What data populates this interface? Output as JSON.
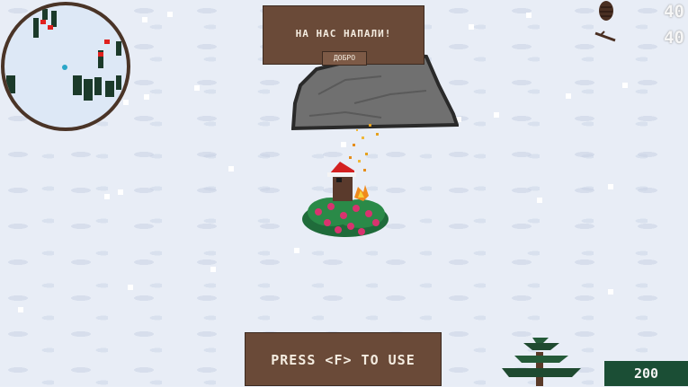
{
  "dialog": {
    "message": "НА НАС НАПАЛИ!",
    "button_label": "ДОБРО"
  },
  "prompt": {
    "text": "PRESS <F> TO USE"
  },
  "counters": {
    "top": "40",
    "second": "40"
  },
  "score": {
    "value": "200"
  },
  "colors": {
    "panel": "#6a4a38",
    "score_bg": "#1b4e35",
    "snow": "#e8edf6"
  },
  "icons": [
    "pine-cone-icon",
    "stick-icon"
  ]
}
